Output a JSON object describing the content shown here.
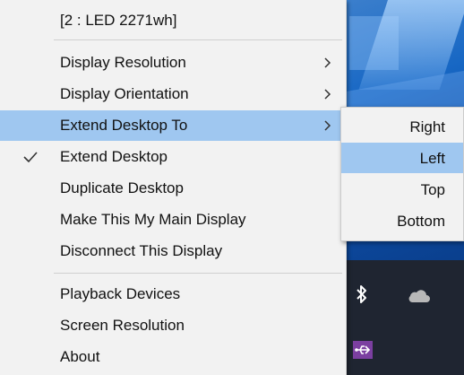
{
  "menu": {
    "header": "[2 : LED 2271wh]",
    "items": [
      {
        "label": "Display Resolution"
      },
      {
        "label": "Display Orientation"
      },
      {
        "label": "Extend Desktop To"
      },
      {
        "label": "Extend Desktop"
      },
      {
        "label": "Duplicate Desktop"
      },
      {
        "label": "Make This My Main Display"
      },
      {
        "label": "Disconnect This Display"
      },
      {
        "label": "Playback Devices"
      },
      {
        "label": "Screen Resolution"
      },
      {
        "label": "About"
      }
    ],
    "highlight_color": "#9fc7f0",
    "background_color": "#f2f2f2"
  },
  "submenu": {
    "items": [
      {
        "label": "Right"
      },
      {
        "label": "Left"
      },
      {
        "label": "Top"
      },
      {
        "label": "Bottom"
      }
    ]
  },
  "tray": {
    "icons": [
      "bluetooth-icon",
      "onedrive-cloud-icon",
      "usb-device-icon"
    ]
  }
}
